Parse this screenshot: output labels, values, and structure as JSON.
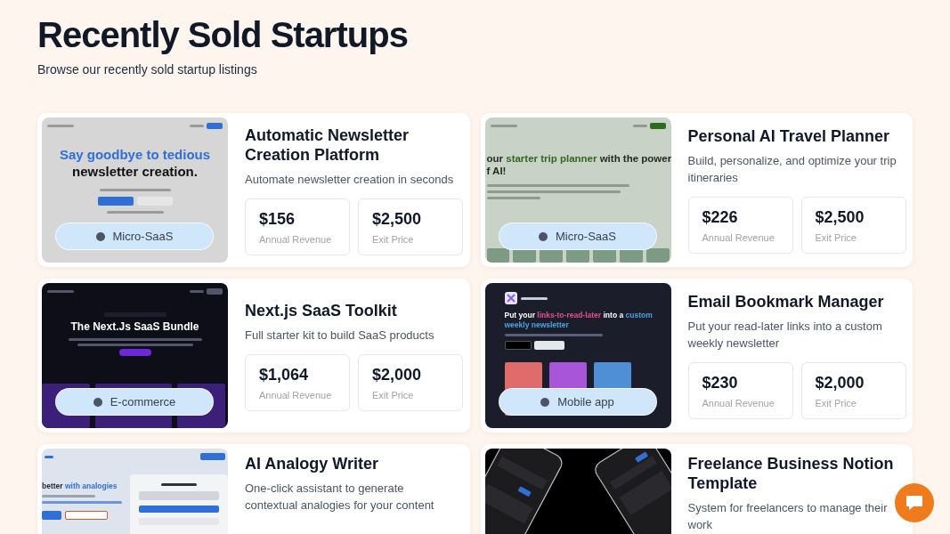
{
  "page": {
    "title": "Recently Sold Startups",
    "subtitle": "Browse our recently sold startup listings"
  },
  "listings": [
    {
      "title": "Automatic Newsletter Creation Platform",
      "description": "Automate newsletter creation in seconds",
      "category": "Micro-SaaS",
      "stats": [
        {
          "value": "$156",
          "label": "Annual Revenue"
        },
        {
          "value": "$2,500",
          "label": "Exit Price"
        }
      ],
      "thumbnail": {
        "kind": "centered",
        "headline": [
          [
            {
              "text": "Say goodbye to tedious",
              "color": "#2f6fd6"
            }
          ],
          [
            {
              "text": "newsletter creation.",
              "color": "#111111"
            }
          ]
        ]
      }
    },
    {
      "title": "Personal AI Travel Planner",
      "description": "Build, personalize, and optimize your trip itineraries",
      "category": "Micro-SaaS",
      "stats": [
        {
          "value": "$226",
          "label": "Annual Revenue"
        },
        {
          "value": "$2,500",
          "label": "Exit Price"
        }
      ],
      "thumbnail": {
        "kind": "left",
        "headline": [
          [
            {
              "text": "our ",
              "color": "#1f2a1f"
            },
            {
              "text": "starter trip planner",
              "color": "#2f6b1f"
            },
            {
              "text": " with the power",
              "color": "#1f2a1f"
            }
          ],
          [
            {
              "text": "f AI!",
              "color": "#1f2a1f"
            }
          ]
        ]
      }
    },
    {
      "title": "Next.js SaaS Toolkit",
      "description": "Full starter kit to build SaaS products",
      "category": "E-commerce",
      "stats": [
        {
          "value": "$1,064",
          "label": "Annual Revenue"
        },
        {
          "value": "$2,000",
          "label": "Exit Price"
        }
      ],
      "thumbnail": {
        "kind": "dark",
        "headline": [
          [
            {
              "text": "The Next.Js SaaS Bundle",
              "color": "#ffffff"
            }
          ]
        ]
      }
    },
    {
      "title": "Email Bookmark Manager",
      "description": "Put your read-later links into a custom weekly newsletter",
      "category": "Mobile app",
      "stats": [
        {
          "value": "$230",
          "label": "Annual Revenue"
        },
        {
          "value": "$2,000",
          "label": "Exit Price"
        }
      ],
      "thumbnail": {
        "kind": "app",
        "headline": [
          [
            {
              "text": "Put your ",
              "color": "#ffffff"
            },
            {
              "text": "links-to-read-later",
              "color": "#e0508f"
            },
            {
              "text": " into a ",
              "color": "#ffffff"
            },
            {
              "text": "custom",
              "color": "#4aa3df"
            }
          ],
          [
            {
              "text": "weekly newsletter",
              "color": "#4aa3df"
            }
          ]
        ],
        "steps": [
          {
            "color": "#e06b6b"
          },
          {
            "color": "#a855d9"
          },
          {
            "color": "#4f8fd6"
          }
        ]
      }
    },
    {
      "title": "AI Analogy Writer",
      "description": "One-click assistant to generate contextual analogies for your content",
      "thumbnail": {
        "kind": "split",
        "headline": [
          [
            {
              "text": "better ",
              "color": "#1f2937"
            },
            {
              "text": "with analogies",
              "color": "#2f6fd6"
            }
          ]
        ]
      }
    },
    {
      "title": "Freelance Business Notion Template",
      "description": "System for freelancers to manage their work",
      "thumbnail": {
        "kind": "phones"
      }
    }
  ]
}
